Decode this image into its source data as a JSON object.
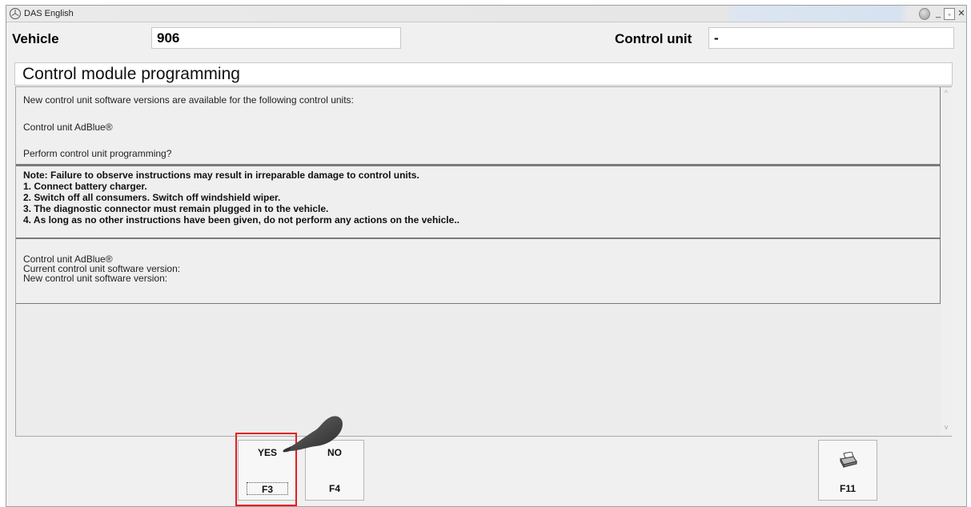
{
  "window": {
    "title": "DAS English"
  },
  "header": {
    "vehicle_label": "Vehicle",
    "vehicle_value": "906",
    "control_unit_label": "Control unit",
    "control_unit_value": "-"
  },
  "page_title": "Control module programming",
  "messages": {
    "line1": "New control unit software versions are available for the following control units:",
    "line2": "Control unit AdBlue®",
    "line3": "Perform control unit programming?"
  },
  "note": {
    "lines": [
      "Note:  Failure to observe instructions may result in irreparable damage to control units.",
      "1. Connect battery charger.",
      "2. Switch off all consumers. Switch off windshield wiper.",
      "3. The diagnostic connector must remain plugged in to the vehicle.",
      "4. As long as no other instructions have been given, do not perform any actions on the vehicle.."
    ]
  },
  "details": {
    "unit": "Control unit AdBlue®",
    "current": "Current control unit software version:",
    "new": "New control unit software version:"
  },
  "buttons": {
    "yes": {
      "label": "YES",
      "key": "F3"
    },
    "no": {
      "label": "NO",
      "key": "F4"
    },
    "print": {
      "label": "",
      "key": "F11",
      "icon": "printer-icon"
    }
  },
  "colors": {
    "highlight": "#e02020"
  }
}
